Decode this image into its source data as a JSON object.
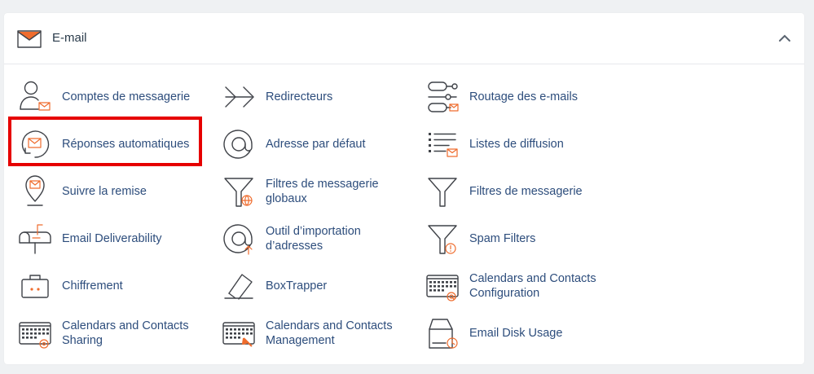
{
  "section": {
    "title": "E-mail",
    "icon": "envelope-icon",
    "collapse_icon": "chevron-up-icon"
  },
  "colors": {
    "link": "#2d4d7c",
    "accent": "#ef6c2d",
    "highlight": "#e60000"
  },
  "items": [
    {
      "label": "Comptes de messagerie",
      "icon": "user-mail-icon"
    },
    {
      "label": "Redirecteurs",
      "icon": "forwarders-arrow-icon"
    },
    {
      "label": "Routage des e-mails",
      "icon": "routing-icon"
    },
    {
      "label": "Réponses automatiques",
      "icon": "autoresponder-icon"
    },
    {
      "label": "Adresse par défaut",
      "icon": "at-sign-icon"
    },
    {
      "label": "Listes de diffusion",
      "icon": "mailing-list-icon"
    },
    {
      "label": "Suivre la remise",
      "icon": "location-pin-mail-icon"
    },
    {
      "label": "Filtres de messagerie globaux",
      "icon": "global-filter-icon"
    },
    {
      "label": "Filtres de messagerie",
      "icon": "filter-icon"
    },
    {
      "label": "Email Deliverability",
      "icon": "mailbox-icon"
    },
    {
      "label": "Outil d’importation d’adresses",
      "icon": "address-import-icon"
    },
    {
      "label": "Spam Filters",
      "icon": "spam-filter-icon"
    },
    {
      "label": "Chiffrement",
      "icon": "briefcase-lock-icon"
    },
    {
      "label": "BoxTrapper",
      "icon": "boxtrapper-icon"
    },
    {
      "label": "Calendars and Contacts Configuration",
      "icon": "calendar-config-icon"
    },
    {
      "label": "Calendars and Contacts Sharing",
      "icon": "calendar-sharing-icon"
    },
    {
      "label": "Calendars and Contacts Management",
      "icon": "calendar-management-icon"
    },
    {
      "label": "Email Disk Usage",
      "icon": "disk-usage-icon"
    }
  ]
}
